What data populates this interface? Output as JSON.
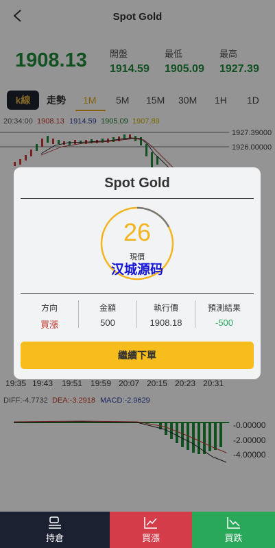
{
  "header": {
    "title": "Spot Gold"
  },
  "price": {
    "current": "1908.13",
    "open_label": "開盤",
    "open": "1914.59",
    "low_label": "最低",
    "low": "1905.09",
    "high_label": "最高",
    "high": "1927.39"
  },
  "tabs": {
    "kline": "k線",
    "trend": "走勢",
    "periods": [
      "1M",
      "5M",
      "15M",
      "30M",
      "1H",
      "1D"
    ]
  },
  "chart": {
    "info_time": "20:34:00",
    "info_open": "1908.13",
    "info_high": "1914.59",
    "info_low": "1905.09",
    "info_close": "1907.89",
    "price_label_1": "1927.39000",
    "price_label_2": "1926.00000",
    "time_ticks": [
      "19:35",
      "19:43",
      "19:51",
      "19:59",
      "20:07",
      "20:15",
      "20:23",
      "20:31"
    ],
    "diff": "DIFF:-4.7732",
    "dea": "DEA:-3.2918",
    "macd": "MACD:-2.9629",
    "macd_ticks": [
      "-0.00000",
      "-2.00000",
      "-4.00000"
    ]
  },
  "modal": {
    "title": "Spot Gold",
    "countdown": "26",
    "countdown_label": "現價",
    "watermark": "汉城源码",
    "direction_label": "方向",
    "direction_value": "買漲",
    "amount_label": "金額",
    "amount_value": "500",
    "exec_label": "執行價",
    "exec_value": "1908.18",
    "result_label": "預測結果",
    "result_value": "-500",
    "continue_label": "繼續下單"
  },
  "bottom": {
    "hold": "持倉",
    "buy_up": "買漲",
    "buy_down": "買跌"
  },
  "colors": {
    "green": "#1f8a3b",
    "gold": "#f6bd1d",
    "red_bg": "#d33c48",
    "green_bg": "#2aa85a",
    "navy_bg": "#1c2132"
  }
}
